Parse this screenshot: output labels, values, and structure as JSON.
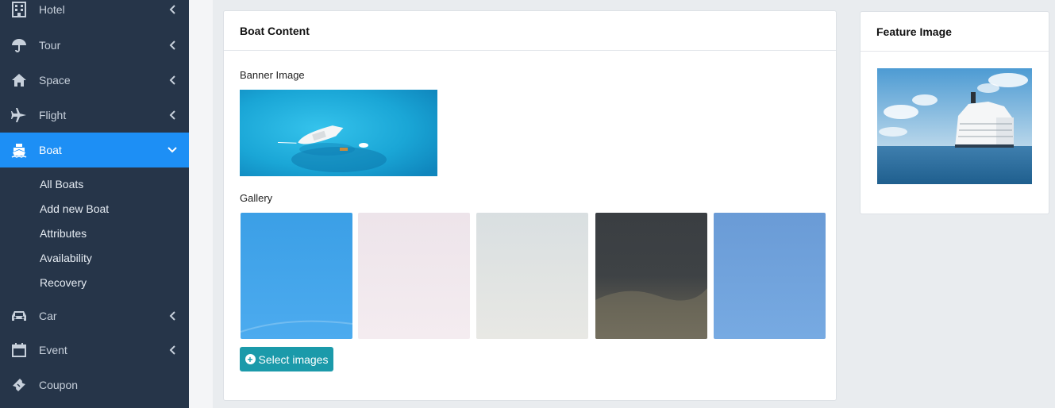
{
  "sidebar": {
    "items": [
      {
        "label": "Hotel",
        "icon": "building-icon"
      },
      {
        "label": "Tour",
        "icon": "umbrella-icon"
      },
      {
        "label": "Space",
        "icon": "home-icon"
      },
      {
        "label": "Flight",
        "icon": "plane-icon"
      },
      {
        "label": "Boat",
        "icon": "ship-icon"
      },
      {
        "label": "Car",
        "icon": "car-icon"
      },
      {
        "label": "Event",
        "icon": "calendar-icon"
      },
      {
        "label": "Coupon",
        "icon": "ticket-icon"
      }
    ],
    "boat_submenu": [
      "All Boats",
      "Add new Boat",
      "Attributes",
      "Availability",
      "Recovery"
    ]
  },
  "boat_content": {
    "title": "Boat Content",
    "banner_label": "Banner Image",
    "gallery_label": "Gallery",
    "select_images": "Select images"
  },
  "feature_image": {
    "title": "Feature Image"
  },
  "colors": {
    "sidebar_bg": "#263549",
    "active_item": "#1d8ff5",
    "button": "#1b9aaa"
  }
}
